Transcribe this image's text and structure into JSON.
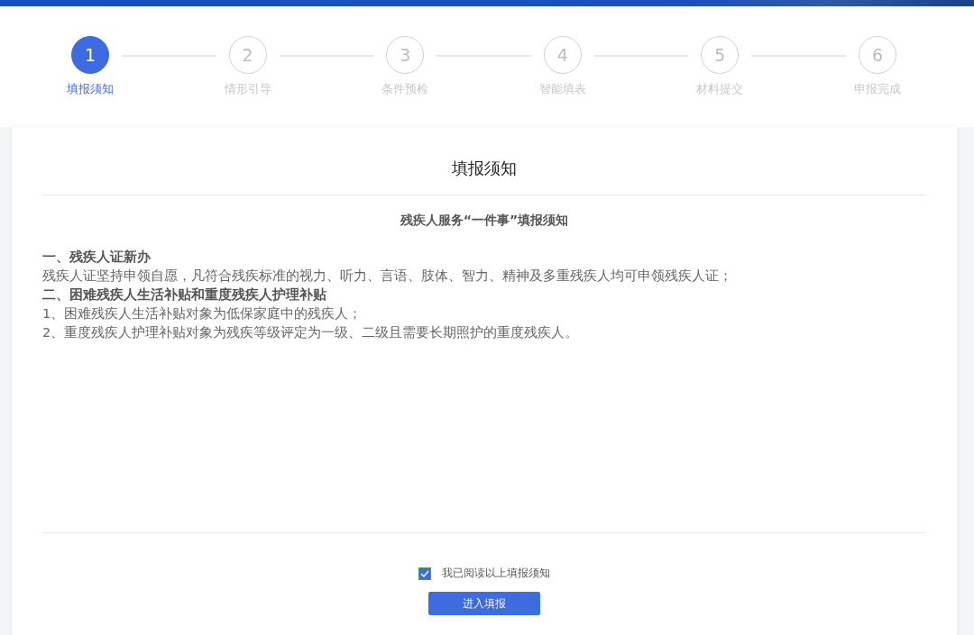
{
  "steps": [
    {
      "number": "1",
      "label": "填报须知",
      "selected": true
    },
    {
      "number": "2",
      "label": "情形引导",
      "selected": false
    },
    {
      "number": "3",
      "label": "条件预检",
      "selected": false
    },
    {
      "number": "4",
      "label": "智能填表",
      "selected": false
    },
    {
      "number": "5",
      "label": "材料提交",
      "selected": false
    },
    {
      "number": "6",
      "label": "申报完成",
      "selected": false
    }
  ],
  "notice": {
    "title": "填报须知",
    "subtitle": "残疾人服务“一件事”填报须知",
    "lines": [
      {
        "kind": "heading",
        "text": "一、残疾人证新办"
      },
      {
        "kind": "body",
        "text": "残疾人证坚持申领自愿，凡符合残疾标准的视力、听力、言语、肢体、智力、精神及多重残疾人均可申领残疾人证；"
      },
      {
        "kind": "heading",
        "text": "二、困难残疾人生活补贴和重度残疾人护理补贴"
      },
      {
        "kind": "body",
        "text": "1、困难残疾人生活补贴对象为低保家庭中的残疾人；"
      },
      {
        "kind": "body",
        "text": "2、重度残疾人护理补贴对象为残疾等级评定为一级、二级且需要长期照护的重度残疾人。"
      }
    ]
  },
  "agreement": {
    "label": "我已阅读以上填报须知",
    "checked": true
  },
  "buttons": [
    "进入填报"
  ]
}
